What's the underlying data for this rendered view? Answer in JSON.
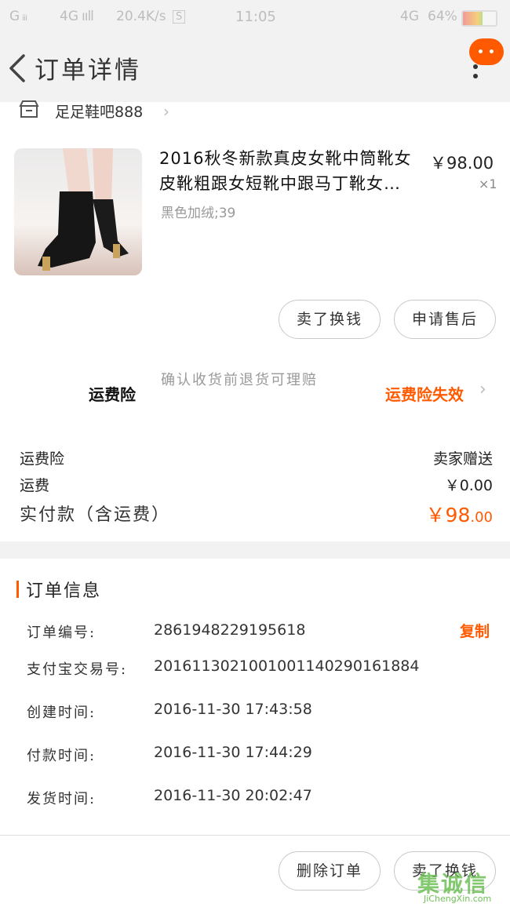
{
  "status_bar": {
    "signal1": "G",
    "signal2": "4G",
    "speed": "20.4K/s",
    "time": "11:05",
    "network": "4G",
    "battery": "64%"
  },
  "header": {
    "title": "订单详情"
  },
  "shop": {
    "name": "足足鞋吧888"
  },
  "product": {
    "title": "2016秋冬新款真皮女靴中筒靴女皮靴粗跟女短靴中跟马丁靴女…",
    "price": "￥98.00",
    "qty": "×1",
    "sku": "黑色加绒;39",
    "buttons": {
      "sell": "卖了换钱",
      "after_sale": "申请售后"
    }
  },
  "insurance": {
    "label": "运费险",
    "desc": "确认收货前退货可理赔",
    "status": "运费险失效"
  },
  "fees": [
    {
      "label": "运费险",
      "value": "卖家赠送"
    },
    {
      "label": "运费",
      "value": "￥0.00"
    }
  ],
  "total": {
    "label": "实付款（含运费）",
    "value_main": "￥98",
    "value_cents": ".00"
  },
  "order_info": {
    "title": "订单信息",
    "copy_label": "复制",
    "rows": [
      {
        "label": "订单编号:",
        "value": "2861948229195618"
      },
      {
        "label": "支付宝交易号:",
        "value": "2016113021001001140290161884"
      },
      {
        "label": "创建时间:",
        "value": "2016-11-30 17:43:58"
      },
      {
        "label": "付款时间:",
        "value": "2016-11-30 17:44:29"
      },
      {
        "label": "发货时间:",
        "value": "2016-11-30 20:02:47"
      }
    ]
  },
  "bottom": {
    "delete": "删除订单",
    "sell": "卖了换钱"
  },
  "watermark": {
    "main": "集诚信",
    "sub": "JiChengXin.com"
  }
}
